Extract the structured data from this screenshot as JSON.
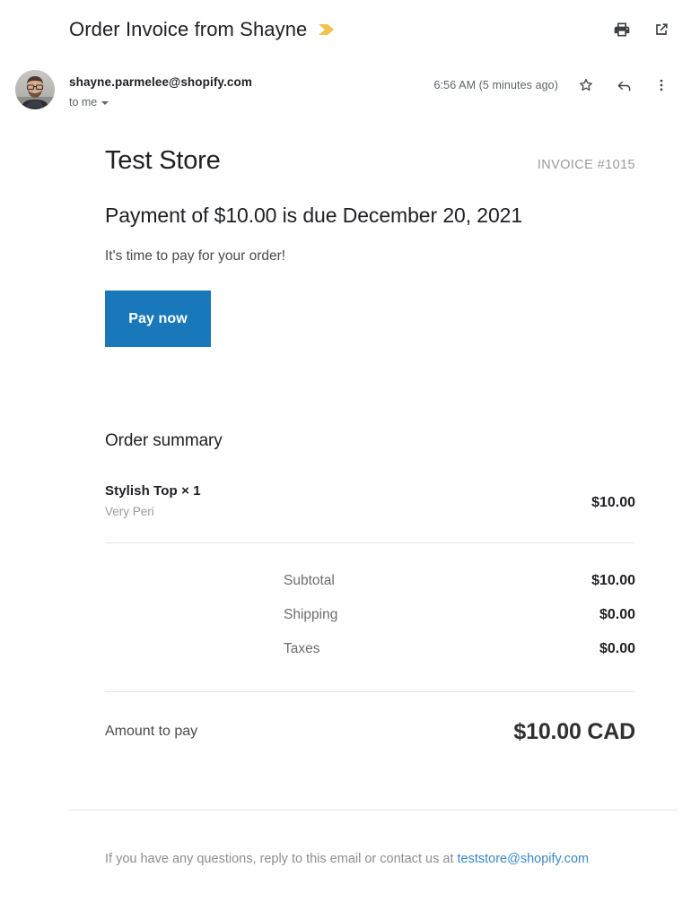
{
  "mail": {
    "subject": "Order Invoice from Shayne",
    "importance_marker": "importance-chevron-icon",
    "actions": {
      "print": "Print all",
      "popout": "Open in new window"
    },
    "sender_email": "shayne.parmelee@shopify.com",
    "recipient": "to me",
    "timestamp": "6:56 AM (5 minutes ago)",
    "star": "Not starred",
    "reply": "Reply",
    "more": "More"
  },
  "invoice": {
    "store_name": "Test Store",
    "invoice_number": "INVOICE #1015",
    "due_line": "Payment of $10.00 is due December 20, 2021",
    "cta_subtext": "It's time to pay for your order!",
    "pay_button": "Pay now",
    "order_summary_title": "Order summary",
    "line_items": [
      {
        "title": "Stylish Top × 1",
        "variant": "Very Peri",
        "price": "$10.00"
      }
    ],
    "totals": [
      {
        "label": "Subtotal",
        "value": "$10.00"
      },
      {
        "label": "Shipping",
        "value": "$0.00"
      },
      {
        "label": "Taxes",
        "value": "$0.00"
      }
    ],
    "grand_total": {
      "label": "Amount to pay",
      "value": "$10.00 CAD"
    },
    "footer": {
      "text_before_link": "If you have any questions, reply to this email or contact us at ",
      "link": "teststore@shopify.com"
    },
    "colors": {
      "pay_button_bg": "#1878b9",
      "link": "#3c87c6",
      "importance_marker": "#f2c14e",
      "muted_text": "#9b9b9b",
      "divider": "#e6e6e6"
    }
  }
}
